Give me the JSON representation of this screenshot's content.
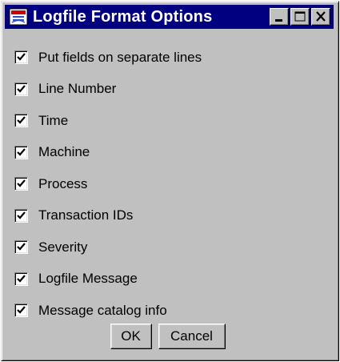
{
  "window": {
    "title": "Logfile Format Options",
    "title_bar_color": "#000080",
    "background_color": "#c0c0c0",
    "icon": "app-icon",
    "controls": [
      {
        "name": "minimize",
        "icon": "minimize-icon"
      },
      {
        "name": "maximize",
        "icon": "maximize-icon"
      },
      {
        "name": "close",
        "icon": "close-icon"
      }
    ]
  },
  "options": [
    {
      "label": "Put fields on separate lines",
      "checked": true
    },
    {
      "label": "Line Number",
      "checked": true
    },
    {
      "label": "Time",
      "checked": true
    },
    {
      "label": "Machine",
      "checked": true
    },
    {
      "label": "Process",
      "checked": true
    },
    {
      "label": "Transaction IDs",
      "checked": true
    },
    {
      "label": "Severity",
      "checked": true
    },
    {
      "label": "Logfile Message",
      "checked": true
    },
    {
      "label": "Message catalog info",
      "checked": true
    }
  ],
  "buttons": {
    "ok_label": "OK",
    "cancel_label": "Cancel"
  }
}
